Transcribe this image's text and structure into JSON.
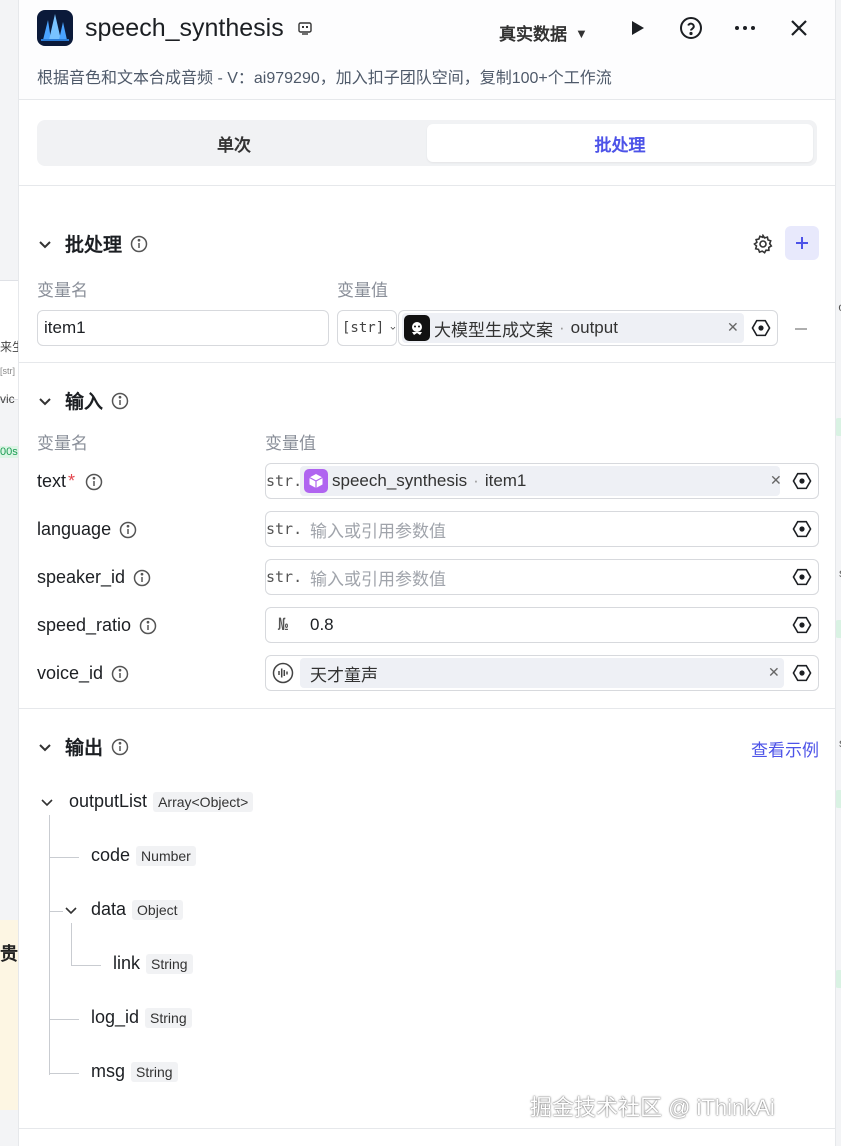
{
  "header": {
    "title": "speech_synthesis",
    "data_mode": "真实数据",
    "subtitle": "根据音色和文本合成音频 - V：ai979290，加入扣子团队空间，复制100+个工作流"
  },
  "tabs": [
    {
      "label": "单次",
      "active": false
    },
    {
      "label": "批处理",
      "active": true
    }
  ],
  "batch": {
    "title": "批处理",
    "col_name": "变量名",
    "col_value": "变量值",
    "item_name": "item1",
    "item_type": "[str]",
    "ref_node": "大模型生成文案",
    "ref_field": "output"
  },
  "inputs": {
    "title": "输入",
    "col_name": "变量名",
    "col_value": "变量值",
    "placeholder": "输入或引用参数值",
    "rows": [
      {
        "name": "text",
        "required": true,
        "type": "str.",
        "ref_node": "speech_synthesis",
        "ref_field": "item1"
      },
      {
        "name": "language",
        "type": "str."
      },
      {
        "name": "speaker_id",
        "type": "str."
      },
      {
        "name": "speed_ratio",
        "type": "№",
        "value": "0.8"
      },
      {
        "name": "voice_id",
        "type": "voice",
        "value": "天才童声"
      }
    ]
  },
  "outputs": {
    "title": "输出",
    "example_link": "查看示例",
    "tree": [
      {
        "name": "outputList",
        "type": "Array<Object>"
      },
      {
        "name": "code",
        "type": "Number"
      },
      {
        "name": "data",
        "type": "Object"
      },
      {
        "name": "link",
        "type": "String"
      },
      {
        "name": "log_id",
        "type": "String"
      },
      {
        "name": "msg",
        "type": "String"
      }
    ]
  },
  "watermark": "掘金技术社区 @ iThinkAi",
  "background_fragments": {
    "left": [
      "来生",
      "[str] ·",
      "vic",
      "00s",
      "贵("
    ],
    "right": [
      "o",
      "f",
      "s",
      "t",
      "f",
      "s",
      "t"
    ]
  },
  "colors": {
    "accent": "#4d53e8",
    "required": "#e3464e",
    "chip_bg": "#eef0f5"
  }
}
